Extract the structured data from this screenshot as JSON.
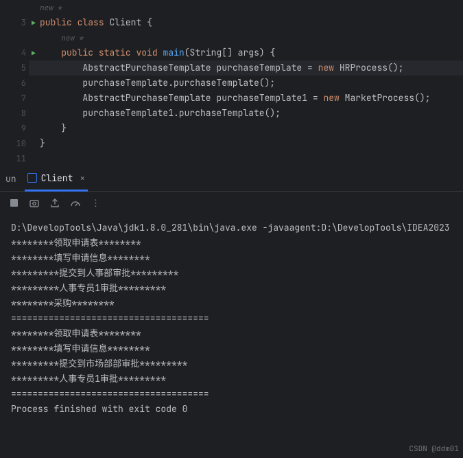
{
  "gutter": {
    "visible_lines": [
      "",
      "3",
      "",
      "4",
      "5",
      "6",
      "7",
      "8",
      "9",
      "10",
      "11"
    ],
    "run_markers": [
      1,
      3
    ],
    "inlay_lines": [
      0,
      2
    ]
  },
  "code": {
    "inlay_new": "new *",
    "l3": {
      "public": "public",
      "class": "class",
      "name": "Client",
      "brace": "{"
    },
    "l4": {
      "public": "public",
      "static": "static",
      "void": "void",
      "main": "main",
      "args": "(String[] args) {",
      "argname": "args"
    },
    "l5": {
      "type": "AbstractPurchaseTemplate",
      "var": "purchaseTemplate",
      "eq": " = ",
      "new": "new",
      "ctor": "HRProcess",
      "end": "();"
    },
    "l6": {
      "stmt": "purchaseTemplate.purchaseTemplate();"
    },
    "l7": {
      "type": "AbstractPurchaseTemplate",
      "var": "purchaseTemplate1",
      "eq": " = ",
      "new": "new",
      "ctor": "MarketProcess",
      "end": "();"
    },
    "l8": {
      "stmt": "purchaseTemplate1.purchaseTemplate();"
    },
    "l9": {
      "brace": "}"
    },
    "l10": {
      "brace": "}"
    }
  },
  "run": {
    "panel_title": "un",
    "tab_name": "Client",
    "close": "×",
    "toolbar": {
      "more": "⋮"
    }
  },
  "console": {
    "cmd": "D:\\DevelopTools\\Java\\jdk1.8.0_281\\bin\\java.exe -javaagent:D:\\DevelopTools\\IDEA2023",
    "o1": "********领取申请表********",
    "o2": "********填写申请信息********",
    "o3": "*********提交到人事部审批*********",
    "o4": "*********人事专员1审批*********",
    "o5": "********采购********",
    "o6": "=====================================",
    "o7": "********领取申请表********",
    "o8": "********填写申请信息********",
    "o9": "*********提交到市场部部审批*********",
    "o10": "*********人事专员1审批*********",
    "o11": "=====================================",
    "blank": "",
    "exit": "Process finished with exit code 0"
  },
  "watermark": "CSDN @ddm01"
}
